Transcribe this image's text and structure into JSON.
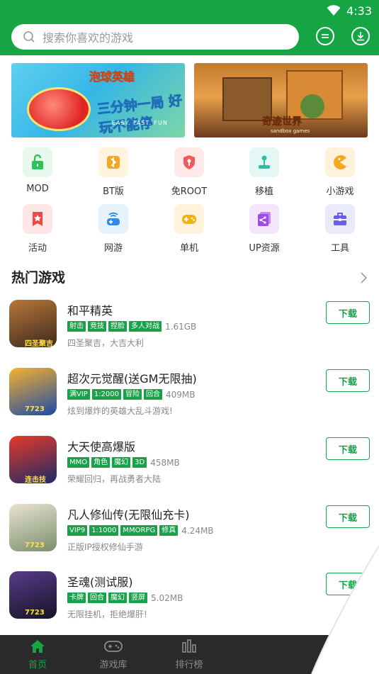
{
  "status": {
    "time": "4:33"
  },
  "header": {
    "search_placeholder": "搜索你喜欢的游戏",
    "colors": {
      "brand": "#16a544"
    }
  },
  "banners": [
    {
      "title": "泡球英雄",
      "slogan": "三分钟一局 好玩不能停",
      "tagline": "EASY. FAST. FUN"
    },
    {
      "title": "奇迹世界",
      "subtitle": "sandbox games"
    }
  ],
  "categories": [
    {
      "label": "MOD",
      "icon": "lock-open-icon",
      "bg": "#e8f8ec",
      "fg": "#2ec35a"
    },
    {
      "label": "BT版",
      "icon": "bt-icon",
      "bg": "#fff4e0",
      "fg": "#f5a623"
    },
    {
      "label": "免ROOT",
      "icon": "shield-key-icon",
      "bg": "#ffe9e9",
      "fg": "#f05a5a"
    },
    {
      "label": "移植",
      "icon": "joystick-icon",
      "bg": "#e3f7f4",
      "fg": "#2bbfa6"
    },
    {
      "label": "小游戏",
      "icon": "pacman-icon",
      "bg": "#fff2dc",
      "fg": "#f5a623"
    },
    {
      "label": "活动",
      "icon": "star-ribbon-icon",
      "bg": "#ffe7e7",
      "fg": "#f04848"
    },
    {
      "label": "网游",
      "icon": "network-gamepad-icon",
      "bg": "#e6f3fd",
      "fg": "#2f8be8"
    },
    {
      "label": "单机",
      "icon": "gamepad-icon",
      "bg": "#fff3de",
      "fg": "#f2b30f"
    },
    {
      "label": "UP资源",
      "icon": "share-stack-icon",
      "bg": "#f4e6fd",
      "fg": "#a14be6"
    },
    {
      "label": "工具",
      "icon": "toolbox-icon",
      "bg": "#ebe9fc",
      "fg": "#6a5ee8"
    }
  ],
  "hot": {
    "title": "热门游戏",
    "download_label": "下载",
    "games": [
      {
        "name": "和平精英",
        "tags": [
          "射击",
          "竞技",
          "捏脸",
          "多人对战"
        ],
        "size": "1.61GB",
        "desc": "四圣聚吉，大吉大利",
        "badge": "四圣聚吉",
        "icon_colors": [
          "#b8763a",
          "#3d2a1d"
        ]
      },
      {
        "name": "超次元觉醒(送GM无限抽)",
        "tags": [
          "满VIP",
          "1:2000",
          "冒险",
          "回合"
        ],
        "size": "409MB",
        "desc": "炫到爆炸的英雄大乱斗游戏!",
        "badge": "7723",
        "icon_colors": [
          "#f7b12b",
          "#1c4aa8"
        ]
      },
      {
        "name": "大天使高爆版",
        "tags": [
          "MMO",
          "角色",
          "魔幻",
          "3D"
        ],
        "size": "458MB",
        "desc": "荣耀回归，再战勇者大陆",
        "badge": "连击技",
        "icon_colors": [
          "#e63a2a",
          "#1d2a66"
        ]
      },
      {
        "name": "凡人修仙传(无限仙充卡)",
        "tags": [
          "VIP9",
          "1:1000",
          "MMORPG",
          "修真"
        ],
        "size": "4.24MB",
        "desc": "正版IP授权修仙手游",
        "badge": "7723",
        "icon_colors": [
          "#e9e3d3",
          "#7a8f6a"
        ]
      },
      {
        "name": "圣魂(测试服)",
        "tags": [
          "卡牌",
          "回合",
          "魔幻",
          "竖屏"
        ],
        "size": "5.02MB",
        "desc": "无限挂机，拒绝爆肝!",
        "badge": "7723",
        "icon_colors": [
          "#5a3b8a",
          "#141426"
        ]
      }
    ]
  },
  "tabs": [
    {
      "label": "首页",
      "icon": "home-icon",
      "active": true
    },
    {
      "label": "游戏库",
      "icon": "gamepad-icon",
      "active": false
    },
    {
      "label": "排行榜",
      "icon": "ranking-icon",
      "active": false
    }
  ]
}
